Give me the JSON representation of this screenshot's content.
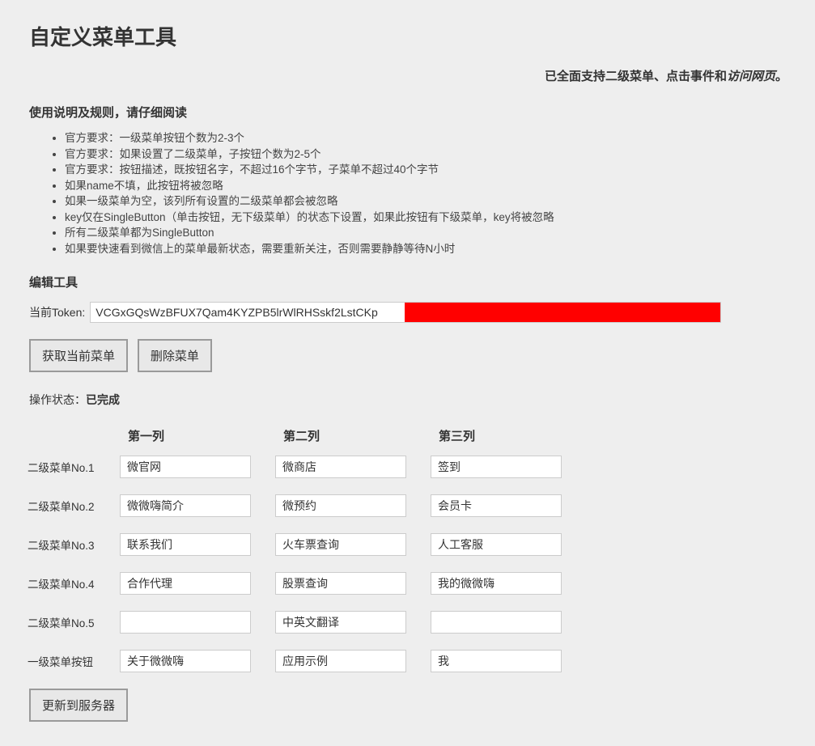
{
  "title": "自定义菜单工具",
  "support_note": {
    "prefix": "已全面支持二级菜单、点击事件和",
    "italic_part": "访问网页",
    "suffix": "。"
  },
  "rules_heading": "使用说明及规则，请仔细阅读",
  "rules": [
    "官方要求：一级菜单按钮个数为2-3个",
    "官方要求：如果设置了二级菜单，子按钮个数为2-5个",
    "官方要求：按钮描述，既按钮名字，不超过16个字节，子菜单不超过40个字节",
    "如果name不填，此按钮将被忽略",
    "如果一级菜单为空，该列所有设置的二级菜单都会被忽略",
    "key仅在SingleButton（单击按钮，无下级菜单）的状态下设置，如果此按钮有下级菜单，key将被忽略",
    "所有二级菜单都为SingleButton",
    "如果要快速看到微信上的菜单最新状态，需要重新关注，否则需要静静等待N小时"
  ],
  "edit_tool_heading": "编辑工具",
  "token": {
    "label": "当前Token:",
    "value": "VCGxGQsWzBFUX7Qam4KYZPB5lrWlRHSskf2LstCKp"
  },
  "buttons": {
    "get_current": "获取当前菜单",
    "delete_menu": "删除菜单",
    "update_server": "更新到服务器"
  },
  "status": {
    "label": "操作状态：",
    "value": "已完成"
  },
  "grid": {
    "col_headers": [
      "第一列",
      "第二列",
      "第三列"
    ],
    "rows": [
      {
        "label": "二级菜单No.1",
        "cells": [
          "微官网",
          "微商店",
          "签到"
        ]
      },
      {
        "label": "二级菜单No.2",
        "cells": [
          "微微嗨简介",
          "微预约",
          "会员卡"
        ]
      },
      {
        "label": "二级菜单No.3",
        "cells": [
          "联系我们",
          "火车票查询",
          "人工客服"
        ]
      },
      {
        "label": "二级菜单No.4",
        "cells": [
          "合作代理",
          "股票查询",
          "我的微微嗨"
        ]
      },
      {
        "label": "二级菜单No.5",
        "cells": [
          "",
          "中英文翻译",
          ""
        ]
      },
      {
        "label": "一级菜单按钮",
        "cells": [
          "关于微微嗨",
          "应用示例",
          "我"
        ]
      }
    ]
  }
}
